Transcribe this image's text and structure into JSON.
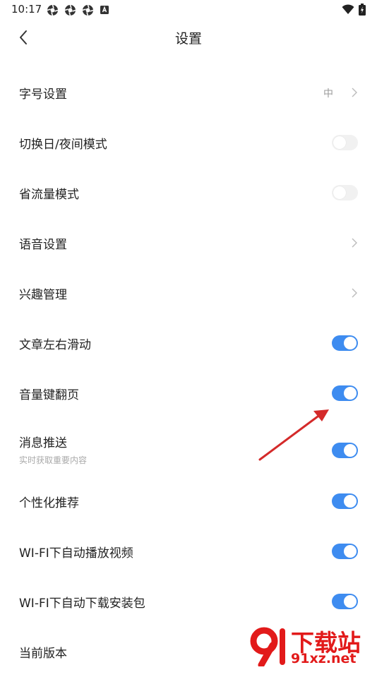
{
  "status_bar": {
    "time": "10:17",
    "left_icons": [
      "aperture-icon",
      "aperture-icon",
      "aperture-icon",
      "a-box-icon"
    ],
    "right_icons": [
      "wifi-icon",
      "battery-charging-icon"
    ]
  },
  "header": {
    "title": "设置"
  },
  "settings": [
    {
      "label": "字号设置",
      "control": "value-chevron",
      "value": "中"
    },
    {
      "label": "切换日/夜间模式",
      "control": "toggle",
      "on": false
    },
    {
      "label": "省流量模式",
      "control": "toggle",
      "on": false
    },
    {
      "label": "语音设置",
      "control": "chevron"
    },
    {
      "label": "兴趣管理",
      "control": "chevron"
    },
    {
      "label": "文章左右滑动",
      "control": "toggle",
      "on": true
    },
    {
      "label": "音量键翻页",
      "control": "toggle",
      "on": true
    },
    {
      "label": "消息推送",
      "sub": "实时获取重要内容",
      "control": "toggle",
      "on": true
    },
    {
      "label": "个性化推荐",
      "control": "toggle",
      "on": true
    },
    {
      "label": "WI-FI下自动播放视频",
      "control": "toggle",
      "on": true
    },
    {
      "label": "WI-FI下自动下载安装包",
      "control": "toggle",
      "on": true
    },
    {
      "label": "当前版本",
      "control": "none"
    }
  ],
  "watermark": {
    "title": "下载站",
    "url": "91xz.net"
  },
  "colors": {
    "toggle_on": "#3e8cf0",
    "toggle_off": "#f1f1f1",
    "annotation_arrow": "#d42a2a",
    "watermark": "#e21a1a"
  }
}
